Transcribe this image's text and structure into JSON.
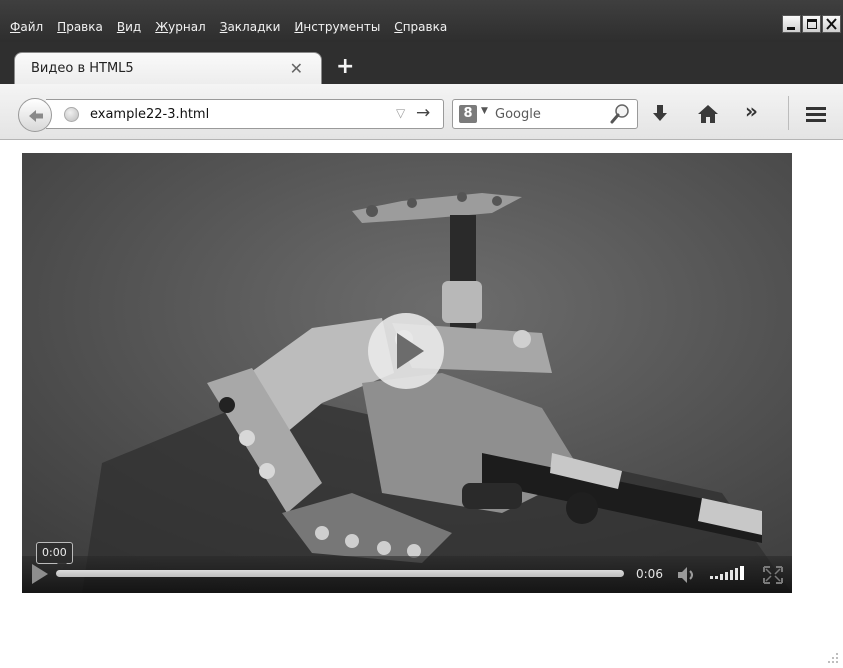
{
  "menubar": {
    "items": [
      {
        "accel": "Ф",
        "rest": "айл"
      },
      {
        "accel": "П",
        "rest": "равка"
      },
      {
        "accel": "В",
        "rest": "ид"
      },
      {
        "accel": "Ж",
        "rest": "урнал"
      },
      {
        "accel": "З",
        "rest": "акладки"
      },
      {
        "accel": "И",
        "rest": "нструменты"
      },
      {
        "accel": "С",
        "rest": "правка"
      }
    ]
  },
  "tabs": {
    "active_title": "Видео в HTML5",
    "close_glyph": "✕",
    "new_tab_glyph": "+"
  },
  "navbar": {
    "url": "example22-3.html",
    "dropmarker_glyph": "▽",
    "go_glyph": "→",
    "search_engine_badge": "8",
    "search_placeholder": "Google",
    "overflow_glyph": "»"
  },
  "video": {
    "current_time_tooltip": "0:00",
    "duration": "0:06",
    "progress": 0.0,
    "volume_level": 1.0
  },
  "colors": {
    "chrome_dark": "#2f2f2f",
    "toolbar": "#e8e8e8",
    "video_controls": "#1a1a1a"
  },
  "icons": [
    "back-arrow-icon",
    "globe-icon",
    "search-magnifier-icon",
    "download-arrow-icon",
    "home-icon",
    "hamburger-menu-icon",
    "play-icon",
    "volume-icon",
    "fullscreen-icon"
  ]
}
